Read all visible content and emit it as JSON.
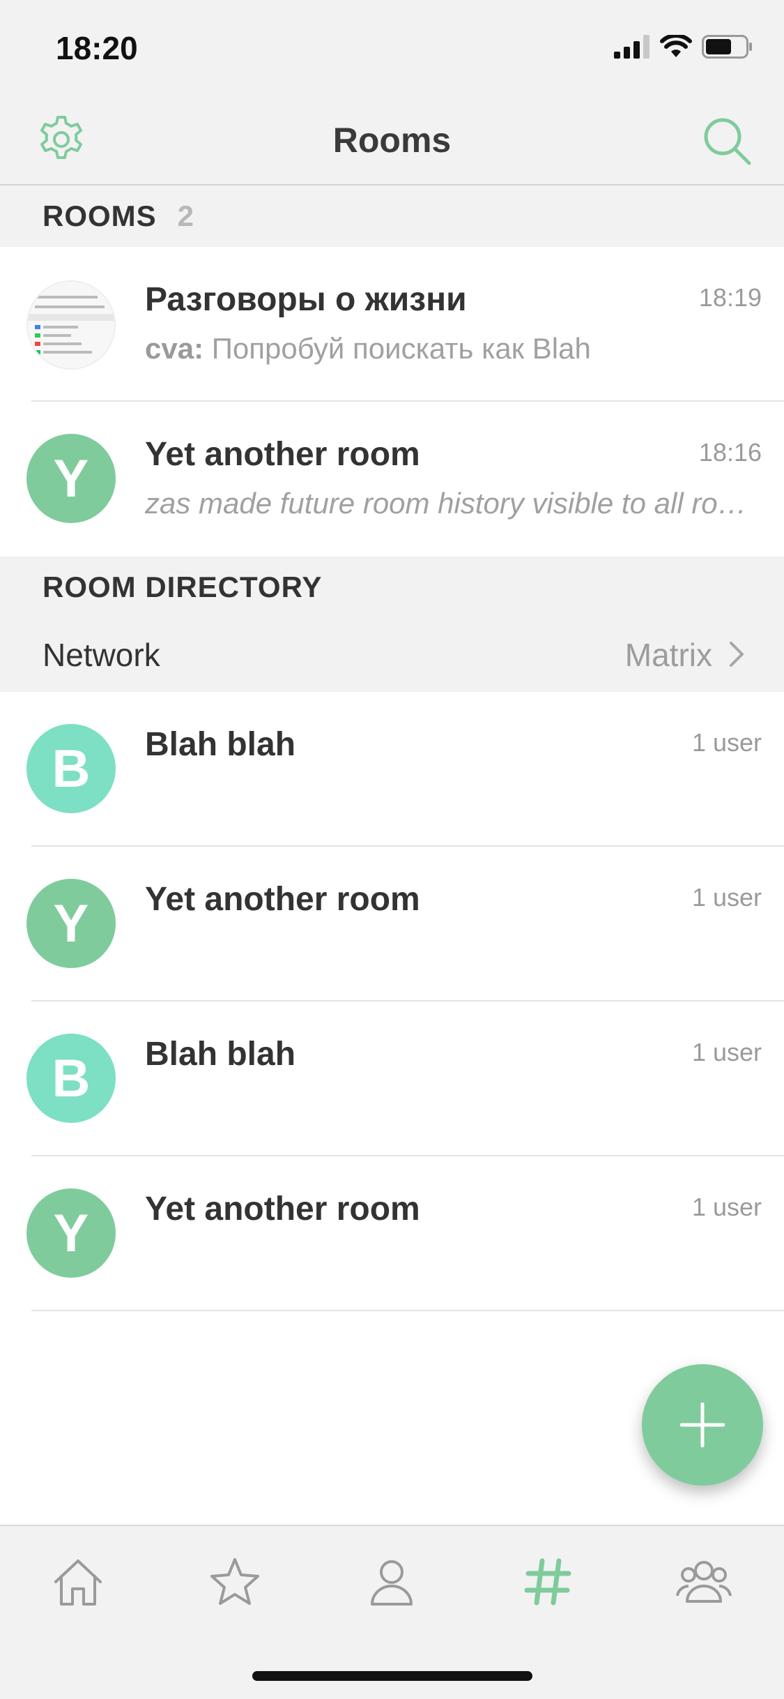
{
  "status_bar": {
    "time": "18:20"
  },
  "nav": {
    "title": "Rooms"
  },
  "rooms_section": {
    "title": "ROOMS",
    "count": "2"
  },
  "rooms": [
    {
      "name": "Разговоры о жизни",
      "time": "18:19",
      "sender": "cva:",
      "preview": " Попробуй поискать как Blah"
    },
    {
      "name": "Yet another room",
      "time": "18:16",
      "avatar_letter": "Y",
      "preview": "zas made future room history visible to all room members"
    }
  ],
  "directory_section": {
    "title": "ROOM DIRECTORY"
  },
  "network": {
    "label": "Network",
    "value": "Matrix"
  },
  "directory": [
    {
      "name": "Blah blah",
      "users": "1 user",
      "avatar_letter": "B",
      "avatar_color": "#7ddfc3"
    },
    {
      "name": "Yet another room",
      "users": "1 user",
      "avatar_letter": "Y",
      "avatar_color": "#7fcb9c"
    },
    {
      "name": "Blah blah",
      "users": "1 user",
      "avatar_letter": "B",
      "avatar_color": "#7ddfc3"
    },
    {
      "name": "Yet another room",
      "users": "1 user",
      "avatar_letter": "Y",
      "avatar_color": "#7fcb9c"
    }
  ],
  "tabs": [
    {
      "icon": "home-icon",
      "active": false
    },
    {
      "icon": "star-icon",
      "active": false
    },
    {
      "icon": "person-icon",
      "active": false
    },
    {
      "icon": "hash-icon",
      "active": true
    },
    {
      "icon": "group-icon",
      "active": false
    }
  ],
  "colors": {
    "accent": "#7fcb9c",
    "avatar_b": "#7ddfc3",
    "inactive_icon": "#9a9a9a"
  }
}
